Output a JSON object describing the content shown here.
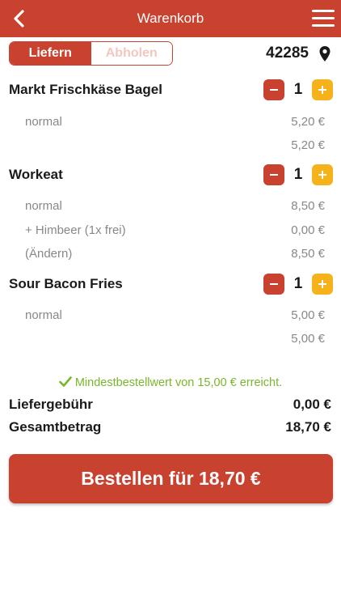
{
  "header": {
    "title": "Warenkorb",
    "back_icon": "chevron-left-icon",
    "menu_icon": "hamburger-menu-icon"
  },
  "delivery_mode": {
    "options": [
      "Liefern",
      "Abholen"
    ],
    "selected": "Liefern"
  },
  "location": {
    "zip": "42285",
    "icon": "map-pin-icon"
  },
  "items": [
    {
      "name": "Markt Frischkäse Bagel",
      "quantity": "1",
      "lines": [
        {
          "label": "normal",
          "price": "5,20 €"
        }
      ],
      "subtotal": "5,20 €"
    },
    {
      "name": "Workeat",
      "quantity": "1",
      "lines": [
        {
          "label": "normal",
          "price": "8,50 €"
        },
        {
          "label": "+ Himbeer (1x frei)",
          "price": "0,00 €"
        }
      ],
      "change_label": "(Ändern)",
      "subtotal": "8,50 €"
    },
    {
      "name": "Sour Bacon Fries",
      "quantity": "1",
      "lines": [
        {
          "label": "normal",
          "price": "5,00 €"
        }
      ],
      "subtotal": "5,00 €"
    }
  ],
  "min_order_note": "Mindestbestellwert von 15,00 € erreicht.",
  "summary": {
    "delivery_fee_label": "Liefergebühr",
    "delivery_fee": "0,00 €",
    "total_label": "Gesamtbetrag",
    "total": "18,70 €"
  },
  "order_button": "Bestellen für 18,70 €",
  "colors": {
    "primary": "#c9412f",
    "accent": "#f6b21a",
    "success": "#7ab62a",
    "muted": "#888888"
  }
}
